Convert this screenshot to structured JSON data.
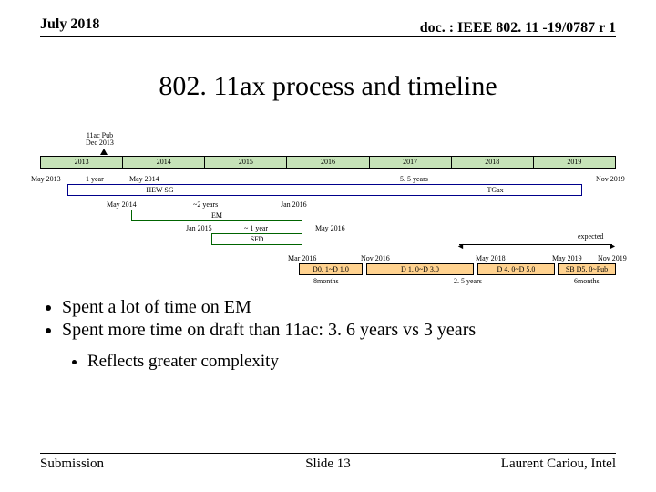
{
  "header": {
    "left": "July 2018",
    "right": "doc. : IEEE 802. 11 -19/0787 r 1"
  },
  "title": "802. 11ax process and timeline",
  "timeline": {
    "pub_note": {
      "line1": "11ac Pub",
      "line2": "Dec 2013"
    },
    "years": [
      "2013",
      "2014",
      "2015",
      "2016",
      "2017",
      "2018",
      "2019"
    ],
    "labels": {
      "may2013": "May 2013",
      "one_year": "1 year",
      "may2014": "May 2014",
      "five_half_years": "5. 5 years",
      "nov2019": "Nov 2019",
      "two_years": "~2 years",
      "jan2016": "Jan 2016",
      "jan2015": "Jan 2015",
      "approx_one_year": "~ 1 year",
      "may2016": "May 2016",
      "expected": "expected",
      "mar2016": "Mar 2016",
      "nov2016": "Nov 2016",
      "may2018": "May 2018",
      "may2019": "May 2019",
      "eight_months": "8months",
      "two_half_years": "2. 5 years",
      "six_months": "6months"
    },
    "hew": {
      "left_label": "HEW SG",
      "right_label": "TGax"
    },
    "em": {
      "label": "EM"
    },
    "sfd": {
      "label": "SFD"
    },
    "phases": [
      {
        "label": "D0. 1~D 1.0"
      },
      {
        "label": "D 1. 0~D 3.0"
      },
      {
        "label": "D 4. 0~D 5.0"
      },
      {
        "label": "SB  D5. 0~Pub"
      }
    ]
  },
  "body": {
    "bullets": [
      "Spent a lot of time on EM",
      "Spent more time on draft than 11ac: 3. 6 years vs 3 years"
    ],
    "sub_bullets": [
      "Reflects greater complexity"
    ]
  },
  "footer": {
    "left": "Submission",
    "mid": "Slide 13",
    "right": "Laurent Cariou, Intel"
  },
  "chart_data": {
    "type": "timeline",
    "title": "802.11ax process and timeline",
    "year_axis": [
      2013,
      2014,
      2015,
      2016,
      2017,
      2018,
      2019
    ],
    "milestones": [
      {
        "label": "11ac Pub",
        "date": "Dec 2013"
      },
      {
        "label": "HEW SG start",
        "date": "May 2013"
      },
      {
        "label": "TGax start",
        "date": "May 2014"
      },
      {
        "label": "TGax end (expected)",
        "date": "Nov 2019"
      }
    ],
    "bars": [
      {
        "name": "HEW SG",
        "start": "May 2013",
        "end": "May 2014",
        "duration": "1 year"
      },
      {
        "name": "TGax",
        "start": "May 2014",
        "end": "Nov 2019",
        "duration": "5.5 years"
      },
      {
        "name": "EM",
        "start": "May 2014",
        "end": "Jan 2016",
        "duration": "~2 years"
      },
      {
        "name": "SFD",
        "start": "Jan 2015",
        "end": "May 2016",
        "duration": "~1 year"
      },
      {
        "name": "D0.1~D1.0",
        "start": "Mar 2016",
        "end": "Nov 2016",
        "duration": "8 months"
      },
      {
        "name": "D1.0~D3.0",
        "start": "Nov 2016",
        "end": "May 2018"
      },
      {
        "name": "D4.0~D5.0",
        "start": "May 2018",
        "end": "May 2019"
      },
      {
        "name": "SB D5.0~Pub",
        "start": "May 2019",
        "end": "Nov 2019",
        "duration": "6 months"
      }
    ],
    "annotations": [
      {
        "text": "expected",
        "range": [
          "May 2018",
          "Nov 2019"
        ]
      },
      {
        "text": "2.5 years",
        "range": [
          "Nov 2016",
          "May 2019"
        ]
      }
    ]
  }
}
